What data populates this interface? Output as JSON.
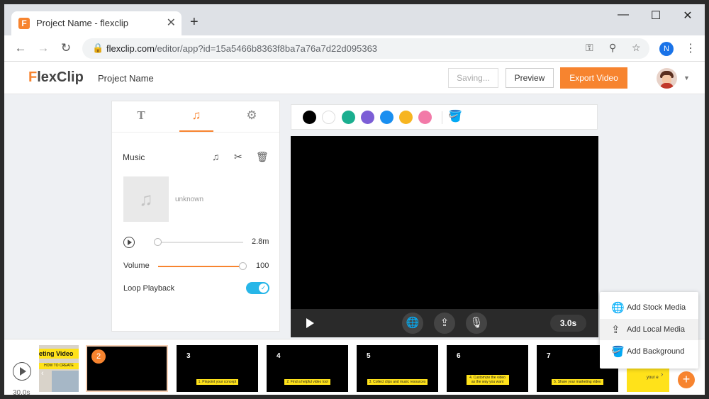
{
  "browser": {
    "tab_title": "Project Name - flexclip",
    "tab_favicon_letter": "F",
    "new_tab": "+",
    "url_host": "flexclip.com",
    "url_path": "/editor/app?id=15a5466b8363f8ba7a76a7d22d095363",
    "profile_initial": "N"
  },
  "app": {
    "logo_mark": "F",
    "logo_text": "lexClip",
    "project_name": "Project Name",
    "saving_label": "Saving...",
    "preview_label": "Preview",
    "export_label": "Export Video",
    "accent_color": "#f7842f"
  },
  "panel": {
    "tabs": [
      "text",
      "music",
      "settings"
    ],
    "active_tab": "music",
    "music_title": "Music",
    "track_name": "unknown",
    "duration": "2.8m",
    "volume_label": "Volume",
    "volume_value": "100",
    "volume_level": 1.0,
    "progress_level": 0.0,
    "loop_label": "Loop Playback",
    "loop_enabled": true
  },
  "palette": {
    "colors": [
      "#000000",
      "#ffffff",
      "#1aae8f",
      "#7c5ed6",
      "#1a8ff0",
      "#f7b521",
      "#f27aa8"
    ]
  },
  "stage": {
    "duration_badge": "3.0s"
  },
  "add_menu": {
    "items": [
      {
        "label": "Add Stock Media",
        "icon": "globe-icon"
      },
      {
        "label": "Add Local Media",
        "icon": "upload-icon"
      },
      {
        "label": "Add Background",
        "icon": "paint-bucket-icon"
      }
    ],
    "highlighted": 1
  },
  "timeline": {
    "time_label": "30.0s",
    "clips": [
      {
        "num": "",
        "caption": "",
        "title": "eting Video",
        "subtitle": "HOW TO CREATE"
      },
      {
        "num": "2",
        "caption": ""
      },
      {
        "num": "3",
        "caption": "1. Pinpoint your concept"
      },
      {
        "num": "4",
        "caption": "2. Find a helpful video tool"
      },
      {
        "num": "5",
        "caption": "3. Collect clips and music resources"
      },
      {
        "num": "6",
        "caption": "4. Customize the video as the way you want"
      },
      {
        "num": "7",
        "caption": "5. Share your marketing video"
      },
      {
        "num": "",
        "caption": "",
        "tail_text": "your e"
      }
    ]
  }
}
